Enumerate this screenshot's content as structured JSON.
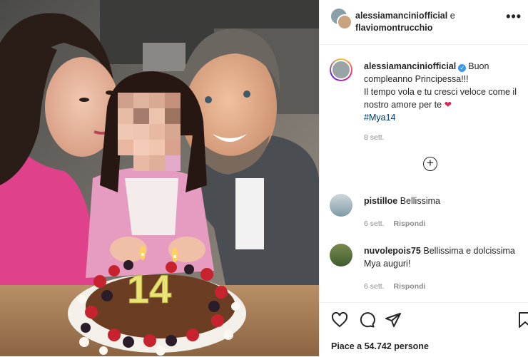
{
  "post": {
    "header": {
      "user1": "alessiamanciniofficial",
      "connector": "e",
      "user2": "flaviomontrucchio",
      "more_icon": "more-horizontal-icon"
    },
    "caption": {
      "username": "alessiamanciniofficial",
      "verified_icon": "verified-badge-icon",
      "line1": "Buon compleanno Principessa!!!",
      "line2": "Il tempo vola e tu cresci veloce come il nostro amore per te",
      "heart": "❤",
      "hashtag": "#Mya14",
      "time": "8 sett."
    },
    "load_more_icon": "plus-circle-icon",
    "comments": [
      {
        "username": "pistilloe",
        "text": "Bellissima",
        "time": "6 sett.",
        "reply": "Rispondi"
      },
      {
        "username": "nuvolepois75",
        "text": "Bellissima e dolcissima Mya auguri!",
        "time": "6 sett.",
        "reply": "Rispondi"
      }
    ],
    "actions": {
      "like_icon": "heart-icon",
      "comment_icon": "comment-icon",
      "share_icon": "share-icon",
      "save_icon": "bookmark-icon",
      "likes_text": "Piace a 54.742 persone"
    },
    "photo": {
      "candle_number": "14"
    }
  }
}
